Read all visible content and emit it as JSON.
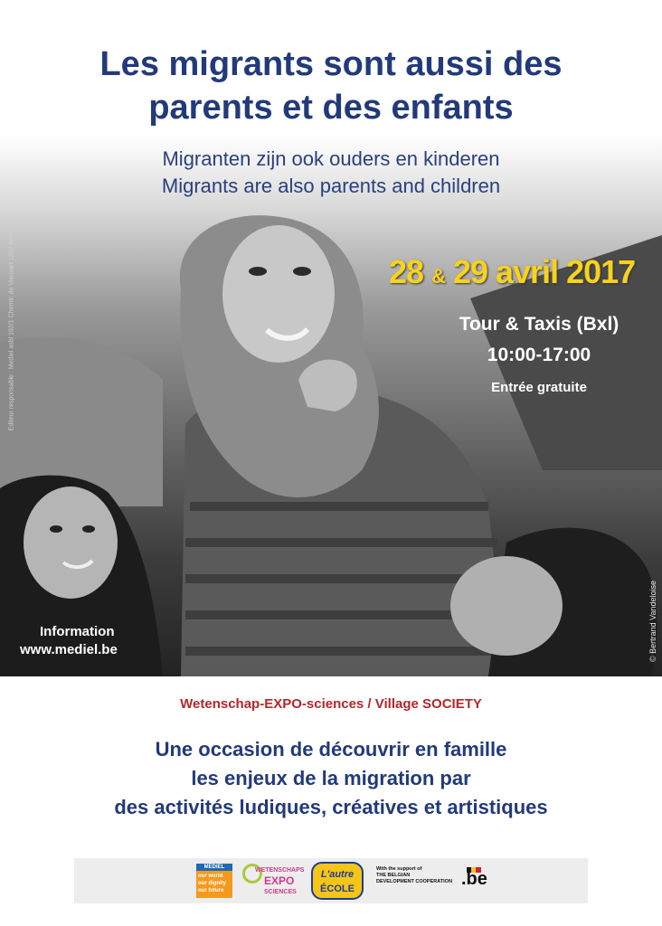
{
  "poster": {
    "title_line1": "Les migrants sont aussi des",
    "title_line2": "parents et des enfants",
    "subtitle_nl": "Migranten zijn ook ouders en kinderen",
    "subtitle_en": "Migrants are also parents and children",
    "side_credit": "Editeur responsable : Mediel asbl 192/1 Chemin de Vieusart 1300 Wavre",
    "photo_credit": "© Bertrand Vandeloise",
    "date_part1": "28",
    "date_amp": "&",
    "date_part2": "29 avril 2017",
    "venue": "Tour & Taxis (Bxl)",
    "hours": "10:00-17:00",
    "admission": "Entrée gratuite",
    "info_label": "Information",
    "info_url": "www.mediel.be",
    "event_name": "Wetenschap-EXPO-sciences / Village SOCIETY",
    "description_line1": "Une occasion de découvrir en famille",
    "description_line2": "les enjeux de la migration par",
    "description_line3": "des activités ludiques, créatives et artistiques"
  },
  "logos": {
    "mediel_name": "MEDIEL",
    "mediel_line1": "our world",
    "mediel_line2": "our dignity",
    "mediel_line3": "our future",
    "expo_word1": "WETENSCHAPS",
    "expo_word2": "EXPO",
    "expo_word3": "SCIENCES",
    "ecole_word1": "L'autre",
    "ecole_word2": "ÉCOLE",
    "support_line1": "With the support of",
    "support_line2": "THE BELGIAN",
    "support_line3": "DEVELOPMENT COOPERATION",
    "be_mark": ".be"
  },
  "colors": {
    "title_blue": "#223a7a",
    "date_yellow": "#f7d21e",
    "event_red": "#b3262a"
  }
}
